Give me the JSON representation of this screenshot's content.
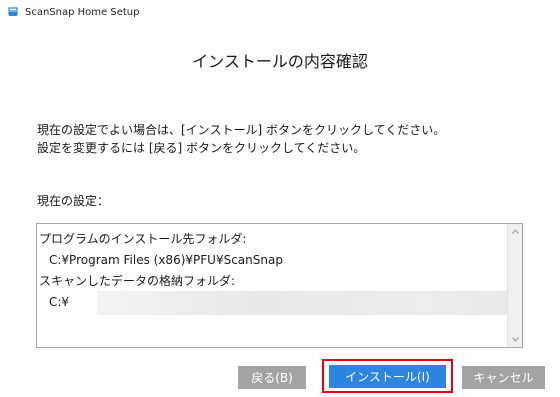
{
  "window": {
    "title": "ScanSnap Home Setup",
    "icon": "scansnap-icon"
  },
  "heading": "インストールの内容確認",
  "description": {
    "line1": "現在の設定でよい場合は、[インストール] ボタンをクリックしてください。",
    "line2": "設定を変更するには [戻る] ボタンをクリックしてください。"
  },
  "current_settings_label": "現在の設定：",
  "settings": {
    "install_folder_label": "プログラムのインストール先フォルダ:",
    "install_folder_value": "C:¥Program Files (x86)¥PFU¥ScanSnap",
    "data_folder_label": "スキャンしたデータの格納フォルダ:",
    "data_folder_value_visible": "C:¥"
  },
  "buttons": {
    "back": "戻る(B)",
    "install": "インストール(I)",
    "cancel": "キャンセル"
  },
  "colors": {
    "accent": "#2c86dd",
    "disabled": "#a3a3a3",
    "highlight": "#e60012"
  }
}
